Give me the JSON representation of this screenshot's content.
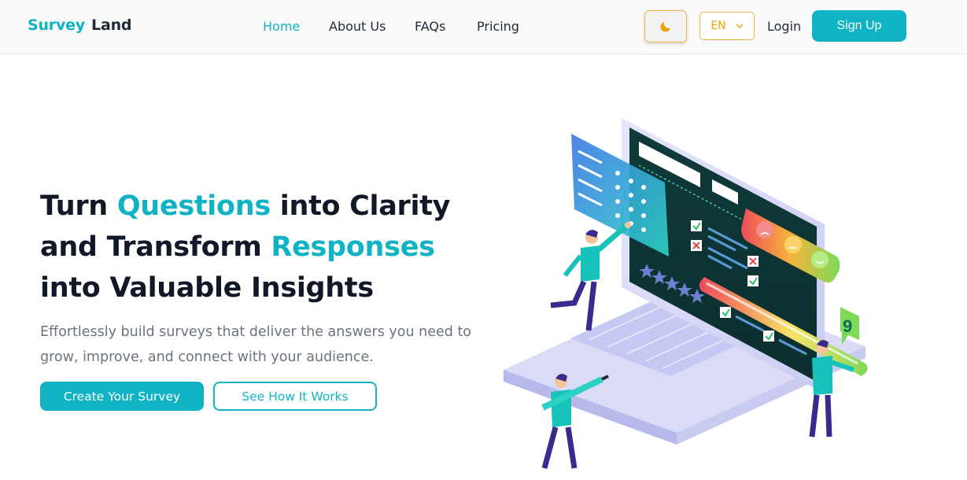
{
  "nav": {
    "logo_part1": "Survey",
    "logo_part2": "Land",
    "links": [
      "Home",
      "About Us",
      "FAQs",
      "Pricing"
    ],
    "active_link": "Home",
    "theme_icon": "moon-icon",
    "language": "EN",
    "login_label": "Login",
    "signup_label": "Sign Up"
  },
  "hero": {
    "title_part1": "Turn ",
    "title_accent1": "Questions",
    "title_part2": " into Clarity and Transform ",
    "title_accent2": "Responses",
    "title_part3": " into Valuable Insights",
    "subtitle": "Effortlessly build surveys that deliver the answers you need to grow, improve, and connect with your audience.",
    "primary_cta": "Create Your Survey",
    "secondary_cta": "See How It Works"
  },
  "illustration": {
    "badge_number": "9"
  },
  "colors": {
    "accent": "#0fb3c4",
    "warning_outline": "#f2b24a",
    "text_dark": "#111827",
    "text_muted": "#6b7280"
  }
}
